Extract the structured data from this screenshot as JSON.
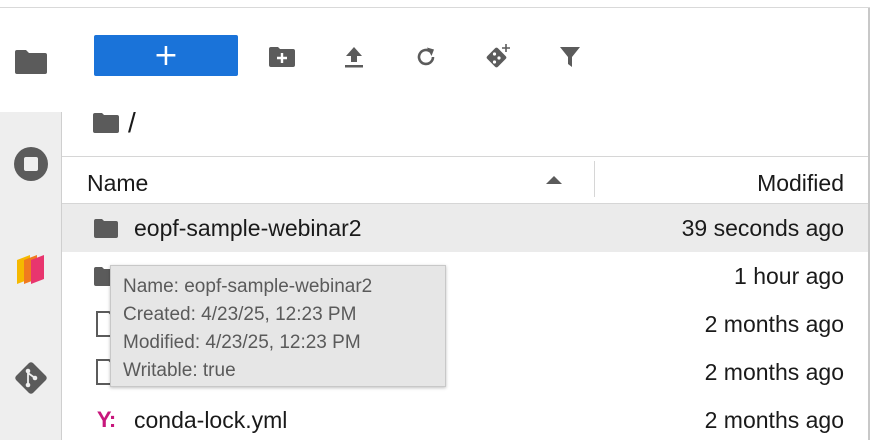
{
  "toolbar": {
    "new_label": "+",
    "buttons": [
      {
        "name": "new-folder",
        "icon": "new-folder-icon"
      },
      {
        "name": "upload",
        "icon": "upload-icon"
      },
      {
        "name": "refresh",
        "icon": "refresh-icon"
      },
      {
        "name": "git-clone",
        "icon": "git-clone-icon"
      },
      {
        "name": "filter",
        "icon": "filter-icon"
      }
    ],
    "accent": "#1a73d9"
  },
  "breadcrumb": {
    "root_icon": "folder-icon",
    "path": "/"
  },
  "activity_bar": [
    {
      "name": "file-browser",
      "icon": "folder-icon",
      "active": true
    },
    {
      "name": "running",
      "icon": "stop-circle-icon"
    },
    {
      "name": "extension",
      "icon": "layers-icon"
    },
    {
      "name": "git",
      "icon": "git-icon"
    }
  ],
  "listing": {
    "columns": {
      "name": "Name",
      "modified": "Modified"
    },
    "sort": "ascending",
    "rows": [
      {
        "type": "folder",
        "name": "eopf-sample-webinar2",
        "modified": "39 seconds ago",
        "selected": true
      },
      {
        "type": "folder",
        "name": "",
        "modified": "1 hour ago"
      },
      {
        "type": "file",
        "name": "",
        "modified": "2 months ago"
      },
      {
        "type": "file",
        "name": "",
        "modified": "2 months ago"
      },
      {
        "type": "yaml",
        "name": "conda-lock.yml",
        "modified": "2 months ago",
        "icon_text": "Y:"
      }
    ]
  },
  "tooltip": {
    "name_line": "Name: eopf-sample-webinar2",
    "created_line": "Created: 4/23/25, 12:23 PM",
    "modified_line": "Modified: 4/23/25, 12:23 PM",
    "writable_line": "Writable: true"
  }
}
